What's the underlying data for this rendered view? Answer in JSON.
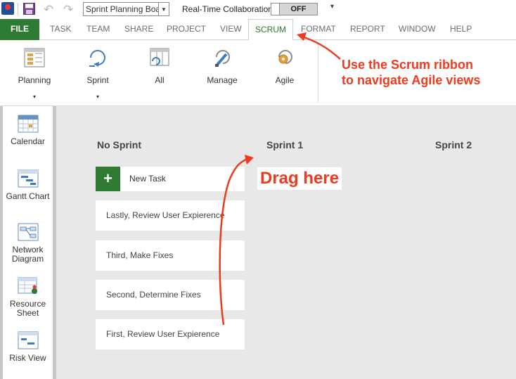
{
  "toolbar": {
    "view_selector_value": "Sprint Planning Board",
    "realtime_label": "Real-Time Collaboration",
    "realtime_toggle": "OFF",
    "more": "▾"
  },
  "tabs": [
    {
      "label": "FILE"
    },
    {
      "label": "TASK"
    },
    {
      "label": "TEAM"
    },
    {
      "label": "SHARE"
    },
    {
      "label": "PROJECT"
    },
    {
      "label": "VIEW"
    },
    {
      "label": "SCRUM"
    },
    {
      "label": "FORMAT"
    },
    {
      "label": "REPORT"
    },
    {
      "label": "WINDOW"
    },
    {
      "label": "HELP"
    }
  ],
  "ribbon": {
    "planning": "Planning",
    "sprint": "Sprint",
    "all": "All",
    "manage": "Manage",
    "agile": "Agile",
    "dropdown_glyph": "▾"
  },
  "views": {
    "calendar": "Calendar",
    "gantt": "Gantt Chart",
    "network": "Network Diagram",
    "resource": "Resource Sheet",
    "risk": "Risk View"
  },
  "board": {
    "columns": [
      "No Sprint",
      "Sprint 1",
      "Sprint 2"
    ],
    "new_task": "New Task",
    "plus": "+",
    "cards": [
      "Lastly, Review User Expierence",
      "Third, Make Fixes",
      "Second, Determine Fixes",
      "First, Review User Expierence"
    ]
  },
  "annotations": {
    "scrum_line1": "Use the Scrum ribbon",
    "scrum_line2": "to navigate Agile views",
    "drag": "Drag here"
  },
  "colors": {
    "accent_green": "#2d7a32",
    "annotation_red": "#ef3a1d"
  }
}
